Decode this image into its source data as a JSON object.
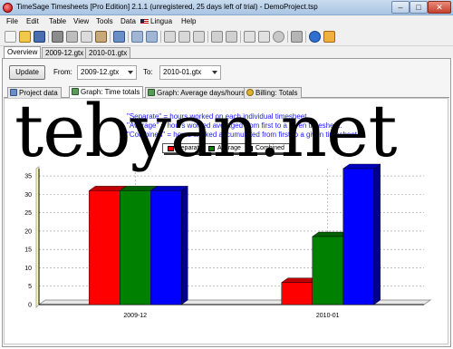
{
  "window": {
    "title": "TimeSage Timesheets [Pro Edition] 2.1.1 (unregistered, 25 days left of trial) - DemoProject.tsp"
  },
  "menu": [
    "File",
    "Edit",
    "Table",
    "View",
    "Tools",
    "Data",
    "Lingua",
    "Help"
  ],
  "file_tabs": [
    "Overview",
    "2009-12.gtx",
    "2010-01.gtx"
  ],
  "controls": {
    "update_label": "Update",
    "from_label": "From:",
    "from_value": "2009-12.gtx",
    "to_label": "To:",
    "to_value": "2010-01.gtx"
  },
  "view_tabs": [
    "Project data",
    "Graph: Time totals",
    "Graph: Average days/hours",
    "Billing: Totals"
  ],
  "chart_description": [
    "\"Separate\" = hours worked on each individual timesheet.",
    "\"Average\" = hours worked averaged from first to a given timesheet.",
    "\"Combined\" = hours worked accumulated from first to a given timesheet."
  ],
  "watermark": "tebyan.net",
  "chart_data": {
    "type": "bar",
    "categories": [
      "2009-12",
      "2010-01"
    ],
    "series": [
      {
        "name": "Separate",
        "color": "#ff0000",
        "values": [
          31,
          6
        ]
      },
      {
        "name": "Average",
        "color": "#008000",
        "values": [
          31,
          18.5
        ]
      },
      {
        "name": "Combined",
        "color": "#0000ff",
        "values": [
          31,
          37
        ]
      }
    ],
    "y_ticks": [
      "0",
      "5",
      "10",
      "15",
      "20",
      "25",
      "30",
      "35"
    ],
    "ylim": [
      0,
      37
    ],
    "grid": true,
    "legend": "top-center"
  }
}
